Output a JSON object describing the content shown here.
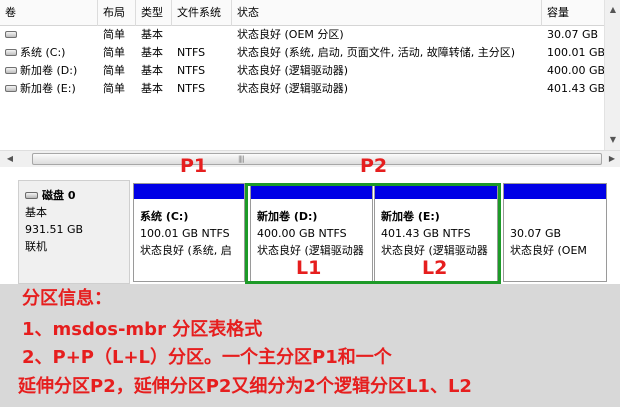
{
  "columns": [
    "卷",
    "布局",
    "类型",
    "文件系统",
    "状态",
    "容量"
  ],
  "volumes": [
    {
      "name": "",
      "layout": "简单",
      "type": "基本",
      "fs": "",
      "status": "状态良好 (OEM 分区)",
      "capacity": "30.07 GB"
    },
    {
      "name": "系统 (C:)",
      "layout": "简单",
      "type": "基本",
      "fs": "NTFS",
      "status": "状态良好 (系统, 启动, 页面文件, 活动, 故障转储, 主分区)",
      "capacity": "100.01 GB"
    },
    {
      "name": "新加卷 (D:)",
      "layout": "简单",
      "type": "基本",
      "fs": "NTFS",
      "status": "状态良好 (逻辑驱动器)",
      "capacity": "400.00 GB"
    },
    {
      "name": "新加卷 (E:)",
      "layout": "简单",
      "type": "基本",
      "fs": "NTFS",
      "status": "状态良好 (逻辑驱动器)",
      "capacity": "401.43 GB"
    }
  ],
  "disk": {
    "name": "磁盘 0",
    "type": "基本",
    "size": "931.51 GB",
    "state": "联机"
  },
  "partitions": [
    {
      "title": "系统  (C:)",
      "size": "100.01 GB NTFS",
      "status": "状态良好 (系统, 启"
    },
    {
      "title": "新加卷  (D:)",
      "size": "400.00 GB NTFS",
      "status": "状态良好 (逻辑驱动器"
    },
    {
      "title": "新加卷  (E:)",
      "size": "401.43 GB NTFS",
      "status": "状态良好 (逻辑驱动器"
    },
    {
      "title": "",
      "size": "30.07 GB",
      "status": "状态良好 (OEM"
    }
  ],
  "annotations": {
    "p1": "P1",
    "p2": "P2",
    "l1": "L1",
    "l2": "L2"
  },
  "info": {
    "heading": "分区信息：",
    "line1": "1、msdos-mbr 分区表格式",
    "line2": "2、P+P（L+L）分区。一个主分区P1和一个",
    "line3": "延伸分区P2，延伸分区P2又细分为2个逻辑分区L1、L2"
  },
  "colors": {
    "partition_bar": "#0000e6",
    "extended_frame": "#1d9a28",
    "annotation_text": "#e61e1e",
    "info_background": "#d8d8d8"
  }
}
